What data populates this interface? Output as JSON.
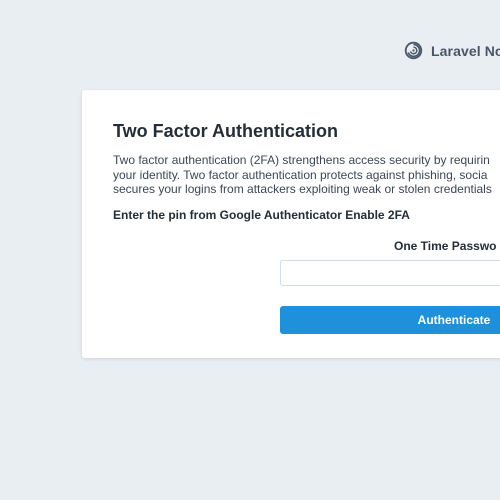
{
  "brand": {
    "name": "Laravel Nova",
    "icon": "laravel-nova-logo-icon"
  },
  "card": {
    "title": "Two Factor Authentication",
    "description_lines": [
      "Two factor authentication (2FA) strengthens access security by requirin",
      "your identity. Two factor authentication protects against phishing, socia",
      "secures your logins from attackers exploiting weak or stolen credentials"
    ],
    "instruction": "Enter the pin from Google Authenticator Enable 2FA",
    "otp_label": "One Time Passwo",
    "otp_value": "",
    "otp_placeholder": "",
    "button_label": "Authenticate"
  },
  "colors": {
    "background": "#e9eef3",
    "card": "#ffffff",
    "accent": "#1e90dc",
    "heading": "#252d37",
    "body_text": "#3c4655"
  }
}
